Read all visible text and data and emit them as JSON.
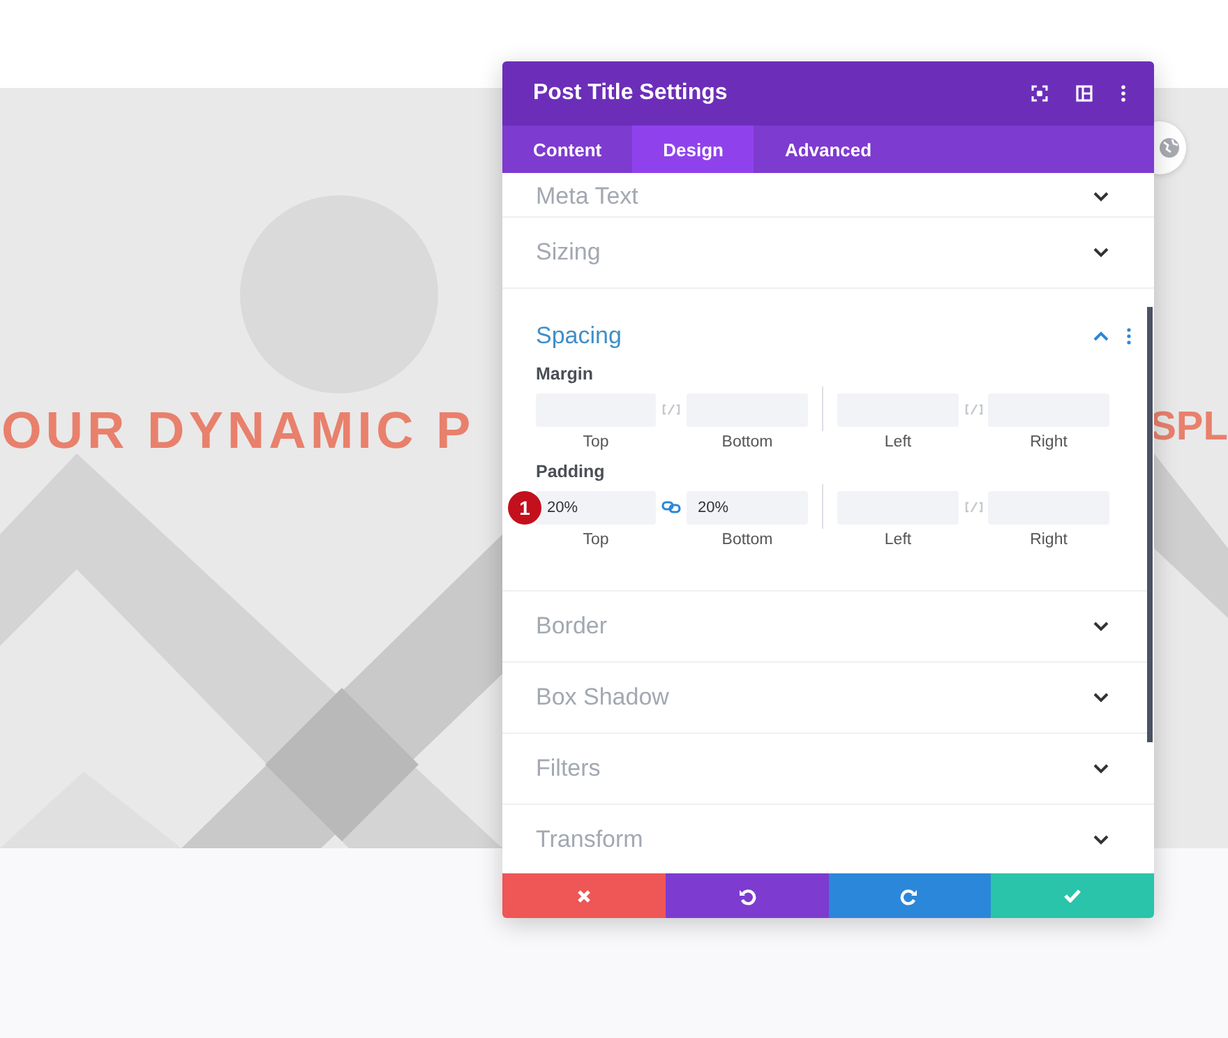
{
  "page": {
    "heading_left": "OUR DYNAMIC P",
    "heading_right": "SPL"
  },
  "window": {
    "title": "Post Title Settings"
  },
  "tabs": [
    {
      "label": "Content",
      "selected": false
    },
    {
      "label": "Design",
      "selected": true
    },
    {
      "label": "Advanced",
      "selected": false
    }
  ],
  "sections": [
    {
      "title": "Meta Text",
      "expanded": false
    },
    {
      "title": "Sizing",
      "expanded": false
    },
    {
      "title": "Spacing",
      "expanded": true,
      "groups": [
        {
          "label": "Margin",
          "pairs": [
            {
              "linked": false,
              "fields": [
                {
                  "sublabel": "Top"
                },
                {
                  "sublabel": "Bottom"
                }
              ]
            },
            {
              "linked": false,
              "fields": [
                {
                  "sublabel": "Left"
                },
                {
                  "sublabel": "Right"
                }
              ]
            }
          ]
        },
        {
          "label": "Padding",
          "badge": "1",
          "pairs": [
            {
              "linked": true,
              "fields": [
                {
                  "value": "20%",
                  "sublabel": "Top"
                },
                {
                  "value": "20%",
                  "sublabel": "Bottom"
                }
              ]
            },
            {
              "linked": false,
              "fields": [
                {
                  "sublabel": "Left"
                },
                {
                  "sublabel": "Right"
                }
              ]
            }
          ]
        }
      ]
    },
    {
      "title": "Border",
      "expanded": false
    },
    {
      "title": "Box Shadow",
      "expanded": false
    },
    {
      "title": "Filters",
      "expanded": false
    },
    {
      "title": "Transform",
      "expanded": false
    }
  ],
  "footer_buttons": [
    {
      "kind": "cancel"
    },
    {
      "kind": "undo"
    },
    {
      "kind": "redo"
    },
    {
      "kind": "save"
    }
  ]
}
